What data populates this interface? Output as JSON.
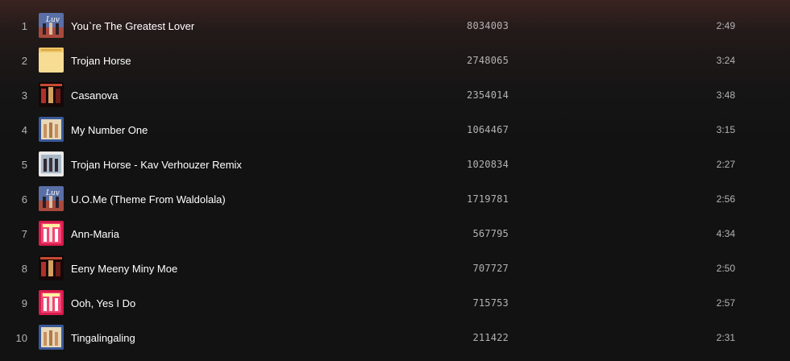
{
  "tracks": [
    {
      "number": "1",
      "title": "You`re The Greatest Lover",
      "plays": "8034003",
      "duration": "2:49",
      "cover": "album-cover-love"
    },
    {
      "number": "2",
      "title": "Trojan Horse",
      "plays": "2748065",
      "duration": "3:24",
      "cover": "album-cover-best-of"
    },
    {
      "number": "3",
      "title": "Casanova",
      "plays": "2354014",
      "duration": "3:48",
      "cover": "album-cover-casanova"
    },
    {
      "number": "4",
      "title": "My Number One",
      "plays": "1064467",
      "duration": "3:15",
      "cover": "album-cover-trio"
    },
    {
      "number": "5",
      "title": "Trojan Horse - Kav Verhouzer Remix",
      "plays": "1020834",
      "duration": "2:27",
      "cover": "album-cover-remix"
    },
    {
      "number": "6",
      "title": "U.O.Me (Theme From Waldolala)",
      "plays": "1719781",
      "duration": "2:56",
      "cover": "album-cover-love"
    },
    {
      "number": "7",
      "title": "Ann-Maria",
      "plays": "567795",
      "duration": "4:34",
      "cover": "album-cover-red"
    },
    {
      "number": "8",
      "title": "Eeny Meeny Miny Moe",
      "plays": "707727",
      "duration": "2:50",
      "cover": "album-cover-casanova"
    },
    {
      "number": "9",
      "title": "Ooh, Yes I Do",
      "plays": "715753",
      "duration": "2:57",
      "cover": "album-cover-red"
    },
    {
      "number": "10",
      "title": "Tingalingaling",
      "plays": "211422",
      "duration": "2:31",
      "cover": "album-cover-trio"
    }
  ],
  "colors": {
    "background": "#121212",
    "header_gradient": "#3a2320",
    "primary_text": "#ffffff",
    "secondary_text": "#b3b3b3"
  }
}
